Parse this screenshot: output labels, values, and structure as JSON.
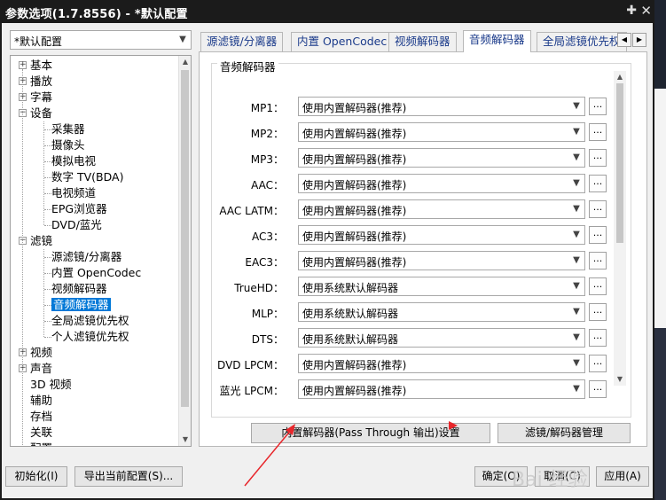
{
  "window": {
    "title": "参数选项(1.7.8556) - *默认配置"
  },
  "preset": {
    "value": "*默认配置"
  },
  "tree": {
    "items": [
      {
        "label": "基本",
        "level": 0,
        "expander": "+"
      },
      {
        "label": "播放",
        "level": 0,
        "expander": "+"
      },
      {
        "label": "字幕",
        "level": 0,
        "expander": "+"
      },
      {
        "label": "设备",
        "level": 0,
        "expander": "−"
      },
      {
        "label": "采集器",
        "level": 1
      },
      {
        "label": "摄像头",
        "level": 1
      },
      {
        "label": "模拟电视",
        "level": 1
      },
      {
        "label": "数字 TV(BDA)",
        "level": 1
      },
      {
        "label": "电视频道",
        "level": 1
      },
      {
        "label": "EPG浏览器",
        "level": 1
      },
      {
        "label": "DVD/蓝光",
        "level": 1
      },
      {
        "label": "滤镜",
        "level": 0,
        "expander": "−"
      },
      {
        "label": "源滤镜/分离器",
        "level": 1
      },
      {
        "label": "内置 OpenCodec",
        "level": 1
      },
      {
        "label": "视频解码器",
        "level": 1
      },
      {
        "label": "音频解码器",
        "level": 1,
        "selected": true
      },
      {
        "label": "全局滤镜优先权",
        "level": 1
      },
      {
        "label": "个人滤镜优先权",
        "level": 1
      },
      {
        "label": "视频",
        "level": 0,
        "expander": "+"
      },
      {
        "label": "声音",
        "level": 0,
        "expander": "+"
      },
      {
        "label": "3D 视频",
        "level": 0
      },
      {
        "label": "辅助",
        "level": 0
      },
      {
        "label": "存档",
        "level": 0
      },
      {
        "label": "关联",
        "level": 0
      },
      {
        "label": "配置",
        "level": 0
      }
    ]
  },
  "tabs": [
    {
      "label": "源滤镜/分离器"
    },
    {
      "label": "内置 OpenCodec"
    },
    {
      "label": "视频解码器"
    },
    {
      "label": "音频解码器",
      "active": true
    },
    {
      "label": "全局滤镜优先权"
    }
  ],
  "tab_nav": {
    "prev": "◀",
    "next": "▶"
  },
  "group": {
    "label": "音频解码器"
  },
  "decoders": [
    {
      "label": "MP1：",
      "value": "使用内置解码器(推荐)"
    },
    {
      "label": "MP2：",
      "value": "使用内置解码器(推荐)"
    },
    {
      "label": "MP3：",
      "value": "使用内置解码器(推荐)"
    },
    {
      "label": "AAC：",
      "value": "使用内置解码器(推荐)"
    },
    {
      "label": "AAC LATM：",
      "value": "使用内置解码器(推荐)"
    },
    {
      "label": "AC3：",
      "value": "使用内置解码器(推荐)"
    },
    {
      "label": "EAC3：",
      "value": "使用内置解码器(推荐)"
    },
    {
      "label": "TrueHD：",
      "value": "使用系统默认解码器"
    },
    {
      "label": "MLP：",
      "value": "使用系统默认解码器"
    },
    {
      "label": "DTS：",
      "value": "使用系统默认解码器"
    },
    {
      "label": "DVD LPCM：",
      "value": "使用内置解码器(推荐)"
    },
    {
      "label": "蓝光 LPCM：",
      "value": "使用内置解码器(推荐)"
    }
  ],
  "dots_label": "...",
  "panel_buttons": {
    "passthrough": "内置解码器(Pass Through 输出)设置",
    "filter_manage": "滤镜/解码器管理"
  },
  "bottom_buttons": {
    "init": "初始化(I)",
    "export": "导出当前配置(S)...",
    "ok": "确定(O)",
    "cancel": "取消(C)",
    "apply": "应用(A)"
  },
  "watermark": {
    "text": "Bai 经验"
  },
  "colors": {
    "titlebar": "#1b1b1b",
    "selection": "#0078d7",
    "annotation_arrow": "#e8262b",
    "tab_text": "#1a3a8a"
  }
}
